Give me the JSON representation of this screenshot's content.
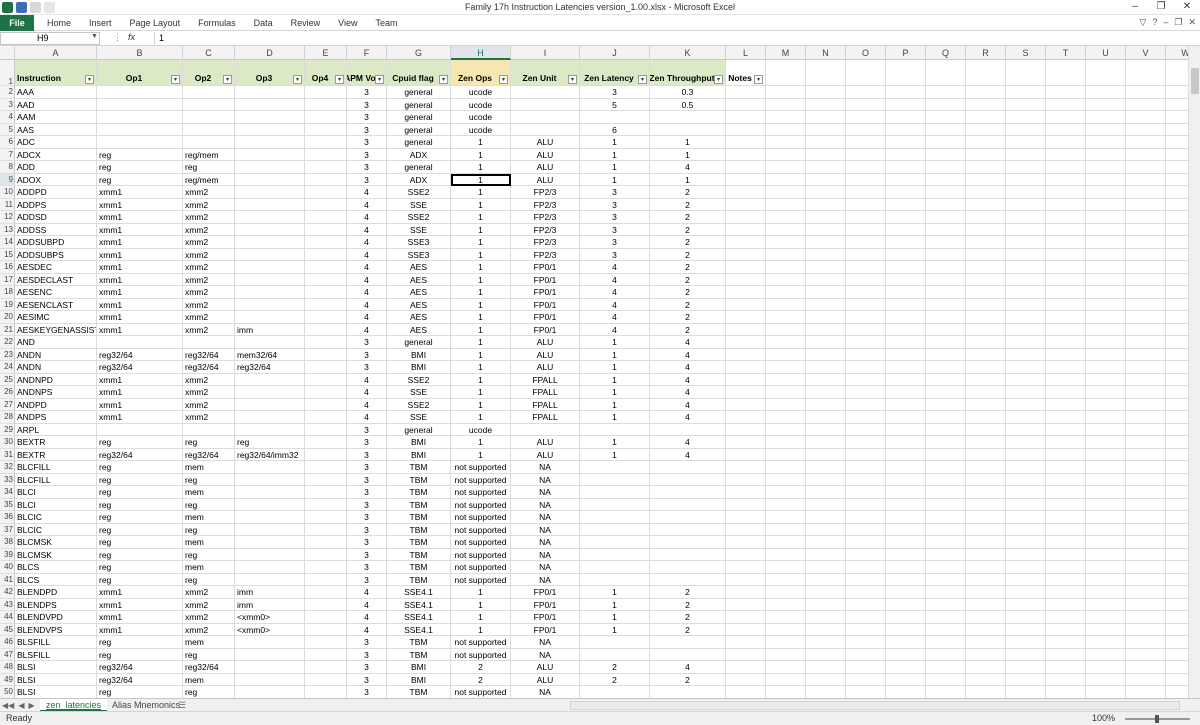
{
  "window": {
    "title": "Family 17h Instruction Latencies version_1.00.xlsx  -  Microsoft Excel",
    "controls": [
      "–",
      "❐",
      "✕"
    ]
  },
  "ribbon": {
    "file_label": "File",
    "tabs": [
      "Home",
      "Insert",
      "Page Layout",
      "Formulas",
      "Data",
      "Review",
      "View",
      "Team"
    ]
  },
  "formula_bar": {
    "name_box": "H9",
    "fx": "fx",
    "value": "1"
  },
  "columns": [
    "A",
    "B",
    "C",
    "D",
    "E",
    "F",
    "G",
    "H",
    "I",
    "J",
    "K",
    "L",
    "M",
    "N",
    "O",
    "P",
    "Q",
    "R",
    "S",
    "T",
    "U",
    "V",
    "W"
  ],
  "selected_column": "H",
  "headers": [
    "Instruction",
    "Op1",
    "Op2",
    "Op3",
    "Op4",
    "APM Vol",
    "Cpuid flag",
    "Zen  Ops",
    "Zen Unit",
    "Zen Latency",
    "Zen Throughput",
    "Notes"
  ],
  "rows": [
    [
      "AAA",
      "",
      "",
      "",
      "",
      "3",
      "general",
      "ucode",
      "",
      "3",
      "0.3"
    ],
    [
      "AAD",
      "",
      "",
      "",
      "",
      "3",
      "general",
      "ucode",
      "",
      "5",
      "0.5"
    ],
    [
      "AAM",
      "",
      "",
      "",
      "",
      "3",
      "general",
      "ucode",
      "",
      "",
      ""
    ],
    [
      "AAS",
      "",
      "",
      "",
      "",
      "3",
      "general",
      "ucode",
      "",
      "6",
      ""
    ],
    [
      "ADC",
      "",
      "",
      "",
      "",
      "3",
      "general",
      "1",
      "ALU",
      "1",
      "1"
    ],
    [
      "ADCX",
      "reg",
      "reg/mem",
      "",
      "",
      "3",
      "ADX",
      "1",
      "ALU",
      "1",
      "1"
    ],
    [
      "ADD",
      "reg",
      "reg",
      "",
      "",
      "3",
      "general",
      "1",
      "ALU",
      "1",
      "4"
    ],
    [
      "ADOX",
      "reg",
      "reg/mem",
      "",
      "",
      "3",
      "ADX",
      "1",
      "ALU",
      "1",
      "1"
    ],
    [
      "ADDPD",
      "xmm1",
      "xmm2",
      "",
      "",
      "4",
      "SSE2",
      "1",
      "FP2/3",
      "3",
      "2"
    ],
    [
      "ADDPS",
      "xmm1",
      "xmm2",
      "",
      "",
      "4",
      "SSE",
      "1",
      "FP2/3",
      "3",
      "2"
    ],
    [
      "ADDSD",
      "xmm1",
      "xmm2",
      "",
      "",
      "4",
      "SSE2",
      "1",
      "FP2/3",
      "3",
      "2"
    ],
    [
      "ADDSS",
      "xmm1",
      "xmm2",
      "",
      "",
      "4",
      "SSE",
      "1",
      "FP2/3",
      "3",
      "2"
    ],
    [
      "ADDSUBPD",
      "xmm1",
      "xmm2",
      "",
      "",
      "4",
      "SSE3",
      "1",
      "FP2/3",
      "3",
      "2"
    ],
    [
      "ADDSUBPS",
      "xmm1",
      "xmm2",
      "",
      "",
      "4",
      "SSE3",
      "1",
      "FP2/3",
      "3",
      "2"
    ],
    [
      "AESDEC",
      "xmm1",
      "xmm2",
      "",
      "",
      "4",
      "AES",
      "1",
      "FP0/1",
      "4",
      "2"
    ],
    [
      "AESDECLAST",
      "xmm1",
      "xmm2",
      "",
      "",
      "4",
      "AES",
      "1",
      "FP0/1",
      "4",
      "2"
    ],
    [
      "AESENC",
      "xmm1",
      "xmm2",
      "",
      "",
      "4",
      "AES",
      "1",
      "FP0/1",
      "4",
      "2"
    ],
    [
      "AESENCLAST",
      "xmm1",
      "xmm2",
      "",
      "",
      "4",
      "AES",
      "1",
      "FP0/1",
      "4",
      "2"
    ],
    [
      "AESIMC",
      "xmm1",
      "xmm2",
      "",
      "",
      "4",
      "AES",
      "1",
      "FP0/1",
      "4",
      "2"
    ],
    [
      "AESKEYGENASSIST",
      "xmm1",
      "xmm2",
      "imm",
      "",
      "4",
      "AES",
      "1",
      "FP0/1",
      "4",
      "2"
    ],
    [
      "AND",
      "",
      "",
      "",
      "",
      "3",
      "general",
      "1",
      "ALU",
      "1",
      "4"
    ],
    [
      "ANDN",
      "reg32/64",
      "reg32/64",
      "mem32/64",
      "",
      "3",
      "BMI",
      "1",
      "ALU",
      "1",
      "4"
    ],
    [
      "ANDN",
      "reg32/64",
      "reg32/64",
      "reg32/64",
      "",
      "3",
      "BMI",
      "1",
      "ALU",
      "1",
      "4"
    ],
    [
      "ANDNPD",
      "xmm1",
      "xmm2",
      "",
      "",
      "4",
      "SSE2",
      "1",
      "FPALL",
      "1",
      "4"
    ],
    [
      "ANDNPS",
      "xmm1",
      "xmm2",
      "",
      "",
      "4",
      "SSE",
      "1",
      "FPALL",
      "1",
      "4"
    ],
    [
      "ANDPD",
      "xmm1",
      "xmm2",
      "",
      "",
      "4",
      "SSE2",
      "1",
      "FPALL",
      "1",
      "4"
    ],
    [
      "ANDPS",
      "xmm1",
      "xmm2",
      "",
      "",
      "4",
      "SSE",
      "1",
      "FPALL",
      "1",
      "4"
    ],
    [
      "ARPL",
      "",
      "",
      "",
      "",
      "3",
      "general",
      "ucode",
      "",
      "",
      ""
    ],
    [
      "BEXTR",
      "reg",
      "reg",
      "reg",
      "",
      "3",
      "BMI",
      "1",
      "ALU",
      "1",
      "4"
    ],
    [
      "BEXTR",
      "reg32/64",
      "reg32/64",
      "reg32/64/imm32",
      "",
      "3",
      "BMI",
      "1",
      "ALU",
      "1",
      "4"
    ],
    [
      "BLCFILL",
      "reg",
      "mem",
      "",
      "",
      "3",
      "TBM",
      "not supported",
      "NA",
      "",
      ""
    ],
    [
      "BLCFILL",
      "reg",
      "reg",
      "",
      "",
      "3",
      "TBM",
      "not supported",
      "NA",
      "",
      ""
    ],
    [
      "BLCI",
      "reg",
      "mem",
      "",
      "",
      "3",
      "TBM",
      "not supported",
      "NA",
      "",
      ""
    ],
    [
      "BLCI",
      "reg",
      "reg",
      "",
      "",
      "3",
      "TBM",
      "not supported",
      "NA",
      "",
      ""
    ],
    [
      "BLCIC",
      "reg",
      "mem",
      "",
      "",
      "3",
      "TBM",
      "not supported",
      "NA",
      "",
      ""
    ],
    [
      "BLCIC",
      "reg",
      "reg",
      "",
      "",
      "3",
      "TBM",
      "not supported",
      "NA",
      "",
      ""
    ],
    [
      "BLCMSK",
      "reg",
      "mem",
      "",
      "",
      "3",
      "TBM",
      "not supported",
      "NA",
      "",
      ""
    ],
    [
      "BLCMSK",
      "reg",
      "reg",
      "",
      "",
      "3",
      "TBM",
      "not supported",
      "NA",
      "",
      ""
    ],
    [
      "BLCS",
      "reg",
      "mem",
      "",
      "",
      "3",
      "TBM",
      "not supported",
      "NA",
      "",
      ""
    ],
    [
      "BLCS",
      "reg",
      "reg",
      "",
      "",
      "3",
      "TBM",
      "not supported",
      "NA",
      "",
      ""
    ],
    [
      "BLENDPD",
      "xmm1",
      "xmm2",
      "imm",
      "",
      "4",
      "SSE4.1",
      "1",
      "FP0/1",
      "1",
      "2"
    ],
    [
      "BLENDPS",
      "xmm1",
      "xmm2",
      "imm",
      "",
      "4",
      "SSE4.1",
      "1",
      "FP0/1",
      "1",
      "2"
    ],
    [
      "BLENDVPD",
      "xmm1",
      "xmm2",
      "<xmm0>",
      "",
      "4",
      "SSE4.1",
      "1",
      "FP0/1",
      "1",
      "2"
    ],
    [
      "BLENDVPS",
      "xmm1",
      "xmm2",
      "<xmm0>",
      "",
      "4",
      "SSE4.1",
      "1",
      "FP0/1",
      "1",
      "2"
    ],
    [
      "BLSFILL",
      "reg",
      "mem",
      "",
      "",
      "3",
      "TBM",
      "not supported",
      "NA",
      "",
      ""
    ],
    [
      "BLSFILL",
      "reg",
      "reg",
      "",
      "",
      "3",
      "TBM",
      "not supported",
      "NA",
      "",
      ""
    ],
    [
      "BLSI",
      "reg32/64",
      "reg32/64",
      "",
      "",
      "3",
      "BMI",
      "2",
      "ALU",
      "2",
      "4"
    ],
    [
      "BLSI",
      "reg32/64",
      "mem",
      "",
      "",
      "3",
      "BMI",
      "2",
      "ALU",
      "2",
      "2"
    ],
    [
      "BLSI",
      "reg",
      "reg",
      "",
      "",
      "3",
      "TBM",
      "not supported",
      "NA",
      "",
      ""
    ]
  ],
  "active_cell": {
    "row": 9,
    "col": "H"
  },
  "sheets": [
    "zen_latencies",
    "Alias Mnemonics"
  ],
  "status": {
    "ready": "Ready",
    "zoom": "100%"
  },
  "colors": {
    "header_fill": "#dbe9c7",
    "excel_green": "#217346"
  }
}
